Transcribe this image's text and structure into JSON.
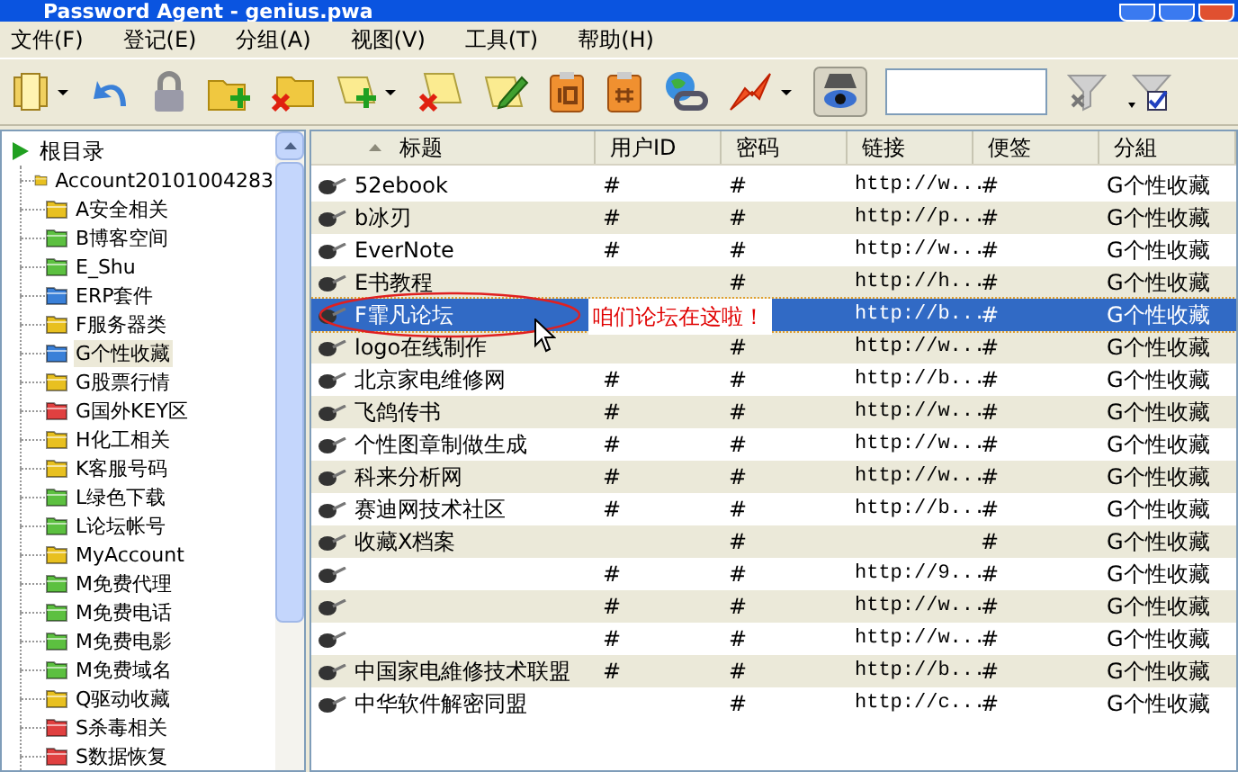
{
  "window": {
    "title": "Password Agent - genius.pwa"
  },
  "menu": [
    {
      "label": "文件(F)"
    },
    {
      "label": "登记(E)"
    },
    {
      "label": "分组(A)"
    },
    {
      "label": "视图(V)"
    },
    {
      "label": "工具(T)"
    },
    {
      "label": "帮助(H)"
    }
  ],
  "tree": {
    "label": "根目录",
    "children": [
      {
        "label": "Account20101004283",
        "color": "#e8c020",
        "selected": false
      },
      {
        "label": "A安全相关",
        "color": "#e8c020",
        "selected": false
      },
      {
        "label": "B博客空间",
        "color": "#5cc040",
        "selected": false
      },
      {
        "label": "E_Shu",
        "color": "#5cc040",
        "selected": false
      },
      {
        "label": "ERP套件",
        "color": "#3a80d8",
        "selected": false
      },
      {
        "label": "F服务器类",
        "color": "#e8c020",
        "selected": false
      },
      {
        "label": "G个性收藏",
        "color": "#3a80d8",
        "selected": true
      },
      {
        "label": "G股票行情",
        "color": "#e8c020",
        "selected": false
      },
      {
        "label": "G国外KEY区",
        "color": "#e04040",
        "selected": false
      },
      {
        "label": "H化工相关",
        "color": "#e8c020",
        "selected": false
      },
      {
        "label": "K客服号码",
        "color": "#e8c020",
        "selected": false
      },
      {
        "label": "L绿色下载",
        "color": "#5cc040",
        "selected": false
      },
      {
        "label": "L论坛帐号",
        "color": "#5cc040",
        "selected": false
      },
      {
        "label": "MyAccount",
        "color": "#e8c020",
        "selected": false
      },
      {
        "label": "M免费代理",
        "color": "#5cc040",
        "selected": false
      },
      {
        "label": "M免费电话",
        "color": "#5cc040",
        "selected": false
      },
      {
        "label": "M免费电影",
        "color": "#5cc040",
        "selected": false
      },
      {
        "label": "M免费域名",
        "color": "#5cc040",
        "selected": false
      },
      {
        "label": "Q驱动收藏",
        "color": "#e8c020",
        "selected": false
      },
      {
        "label": "S杀毒相关",
        "color": "#e04040",
        "selected": false
      },
      {
        "label": "S数据恢复",
        "color": "#e04040",
        "selected": false
      }
    ]
  },
  "table": {
    "columns": [
      {
        "label": "标题",
        "sorted": true
      },
      {
        "label": "用户ID",
        "sorted": false
      },
      {
        "label": "密码",
        "sorted": false
      },
      {
        "label": "链接",
        "sorted": false
      },
      {
        "label": "便签",
        "sorted": false
      },
      {
        "label": "分組",
        "sorted": false
      }
    ],
    "rows": [
      {
        "title": "52ebook",
        "user_id": "#",
        "password": "#",
        "link": "http://w...",
        "note": "#",
        "group": "G个性收藏",
        "selected": false
      },
      {
        "title": "b冰刃",
        "user_id": "#",
        "password": "#",
        "link": "http://p...",
        "note": "#",
        "group": "G个性收藏",
        "selected": false
      },
      {
        "title": "EverNote",
        "user_id": "#",
        "password": "#",
        "link": "http://w...",
        "note": "#",
        "group": "G个性收藏",
        "selected": false
      },
      {
        "title": "E书教程",
        "password": "#",
        "link": "http://h...",
        "note": "#",
        "group": "G个性收藏",
        "selected": false
      },
      {
        "title": "F霏凡论坛",
        "link": "http://b...",
        "note": "#",
        "group": "G个性收藏",
        "selected": true
      },
      {
        "title": "logo在线制作",
        "password": "#",
        "link": "http://w...",
        "note": "#",
        "group": "G个性收藏",
        "selected": false
      },
      {
        "title": "北京家电维修网",
        "user_id": "#",
        "password": "#",
        "link": "http://b...",
        "note": "#",
        "group": "G个性收藏",
        "selected": false
      },
      {
        "title": "飞鸽传书",
        "user_id": "#",
        "password": "#",
        "link": "http://w...",
        "note": "#",
        "group": "G个性收藏",
        "selected": false
      },
      {
        "title": "个性图章制做生成",
        "user_id": "#",
        "password": "#",
        "link": "http://w...",
        "note": "#",
        "group": "G个性收藏",
        "selected": false
      },
      {
        "title": "科来分析网",
        "user_id": "#",
        "password": "#",
        "link": "http://w...",
        "note": "#",
        "group": "G个性收藏",
        "selected": false
      },
      {
        "title": "赛迪网技术社区",
        "user_id": "#",
        "password": "#",
        "link": "http://b...",
        "note": "#",
        "group": "G个性收藏",
        "selected": false
      },
      {
        "title": "收藏X档案",
        "password": "#",
        "note": "#",
        "group": "G个性收藏",
        "selected": false
      },
      {
        "user_id": "#",
        "password": "#",
        "link": "http://9...",
        "note": "#",
        "group": "G个性收藏",
        "selected": false
      },
      {
        "user_id": "#",
        "password": "#",
        "link": "http://w...",
        "note": "#",
        "group": "G个性收藏",
        "selected": false
      },
      {
        "user_id": "#",
        "password": "#",
        "link": "http://w...",
        "note": "#",
        "group": "G个性收藏",
        "selected": false
      },
      {
        "title": "中国家电維修技术联盟",
        "user_id": "#",
        "password": "#",
        "link": "http://b...",
        "note": "#",
        "group": "G个性收藏",
        "selected": false
      },
      {
        "title": "中华软件解密同盟",
        "password": "#",
        "link": "http://c...",
        "note": "#",
        "group": "G个性收藏",
        "selected": false
      }
    ]
  },
  "annotation": {
    "text": "咱们论坛在这啦！"
  }
}
